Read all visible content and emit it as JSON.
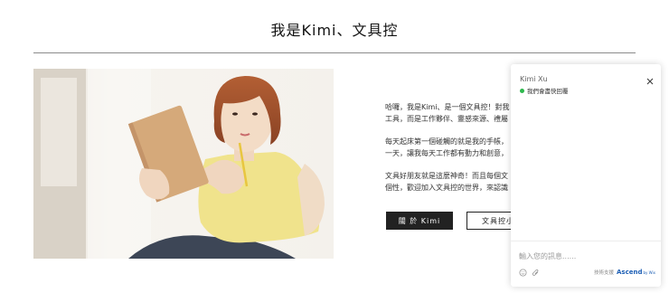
{
  "page": {
    "title": "我是Kimi、文具控"
  },
  "intro": {
    "paragraphs": [
      [
        "哈囉，我是Kimi、是一個文具控！對我",
        "工具，而是工作夥伴、靈感來源、禮屬"
      ],
      [
        "每天起床第一個碰觸的就是我的手帳，",
        "一天，讓我每天工作都有動力和創意，"
      ],
      [
        "文具好朋友就是這麼神奇！而且每個文",
        "個性，歡迎加入文具控的世界，來認識"
      ]
    ]
  },
  "buttons": {
    "about": "關 於 Kimi",
    "secondary": "文具控小"
  },
  "chat": {
    "agent_name": "Kimi Xu",
    "status": "我們會盡快回覆",
    "input_placeholder": "輸入您的訊息......",
    "powered_by": "技術支援",
    "brand": "Ascend",
    "brand_suffix": "by Wix"
  },
  "colors": {
    "status_online": "#2db84d",
    "brand": "#1d5fb5",
    "button_dark": "#222222"
  }
}
